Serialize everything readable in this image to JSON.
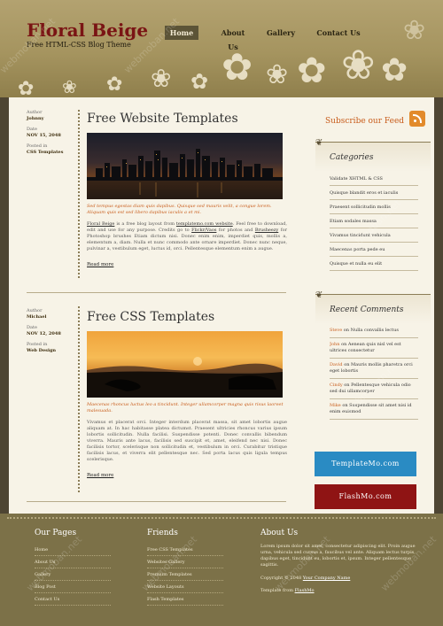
{
  "header": {
    "logo": "Floral Beige",
    "slogan": "Free HTML-CSS Blog Theme",
    "nav": [
      "Home",
      "About Us",
      "Gallery",
      "Contact Us"
    ]
  },
  "posts": [
    {
      "meta": {
        "author_label": "Author",
        "author": "Johnny",
        "date_label": "Date",
        "date": "NOV 15, 2048",
        "posted_label": "Posted in",
        "category": "CSS Templates"
      },
      "title": "Free Website Templates",
      "caption": "Sed tempus egestas diam quis dapibus. Quisque sed mauris velit, a congue lorem. Aliquam quis est sed libero dapibus iaculis a et mi.",
      "intro_parts": [
        "Floral Beige",
        " is a free blog layout from ",
        "templatemo.com website",
        ". Feel free to download, edit and use for any purpose. Credits go to ",
        "Flickr/Vaos",
        " for photos and ",
        "Brusheezy",
        " for Photoshop brushes Etiam dictum nisi. Donec enim enim, imperdiet quis, mollis a, elementum a, diam. Nulla et nunc commodo ante ornare imperdiet. Donec nunc neque, pulvinar a, vestibulum eget, luctus id, orci. Pellentesque elementum enim a augue."
      ],
      "more": "Read more"
    },
    {
      "meta": {
        "author_label": "Author",
        "author": "Michael",
        "date_label": "Date",
        "date": "NOV 12, 2048",
        "posted_label": "Posted in",
        "category": "Web Design"
      },
      "title": "Free CSS Templates",
      "caption": "Maecenas rhoncus luctus leo a tincidunt. Integer ullamcorper magna quis risus laoreet malesuada.",
      "body": "Vivamus et placerat orci. Integer interdum placerat massa, sit amet lobortis augue aliquam at. In hac habitasse platea dictumst. Praesent ultricies rhoncus varius ipsum lobortis sollicitudin. Nulla facilisi. Suspendisse potenti. Donec convallis bibendum viverra. Mauris ante lacus, facilisis sed suscipit et, amet, eleifend nec nisi. Donec facilisis tortor, scelerisque non sollicitudin et, vestibulum in orci. Curabitur tristique facilisis lacus, et viverra elit pellentesque nec. Sed porta lacus quis ligula tempus scelerisque.",
      "more": "Read more"
    }
  ],
  "sidebar": {
    "subscribe": "Subscribe our Feed",
    "categories_title": "Categories",
    "categories": [
      "Validate XHTML & CSS",
      "Quisque blandit eros et iaculis",
      "Praesent sollicitudin mollis",
      "Etiam sodales massa",
      "Vivamus tincidunt vehicula",
      "Maecenas porta pede eu",
      "Quisque et nulla eu elit"
    ],
    "comments_title": "Recent Comments",
    "comments": [
      {
        "who": "Steve",
        "text": "on Nulla convallis lectus"
      },
      {
        "who": "John",
        "text": "on Aenean quis nisl vel est ultrices consectetur"
      },
      {
        "who": "David",
        "text": "on Mauris mollis pharetra orci eget lobortis"
      },
      {
        "who": "Cindy",
        "text": "on Pellentesque vehicula odio sed dui ullamcorper"
      },
      {
        "who": "Mike",
        "text": "on Suspendisse sit amet nisi id enim euismod"
      }
    ],
    "badge1": "TemplateMo.com",
    "badge2": "FlashMo.com"
  },
  "footer": {
    "pages_title": "Our Pages",
    "pages": [
      "Home",
      "About Us",
      "Gallery",
      "Blog Post",
      "Contact Us"
    ],
    "friends_title": "Friends",
    "friends": [
      "Free CSS Templates",
      "Websites Gallery",
      "Premium Templates",
      "Website Layouts",
      "Flash Templates"
    ],
    "about_title": "About Us",
    "about_text": "Lorem ipsum dolor sit amet, consectetur adipiscing elit. Proin augue urna, vehicula sed cursus a, faucibus vel ante. Aliquam lectus turpis, dapibus eget, tincidunt eu, lobortis et, ipsum. Integer pellentesque sagittis.",
    "copyright_prefix": "Copyright © 2048 ",
    "company": "Your Company Name",
    "template_prefix": "Template from ",
    "template_by": "FlashMo"
  },
  "watermark": "webmoban.net"
}
